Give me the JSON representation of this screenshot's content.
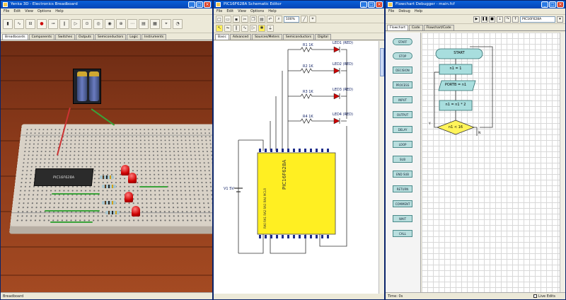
{
  "window1": {
    "title": "Yenka 3D - Electronics Breadboard",
    "menu": [
      "File",
      "Edit",
      "View",
      "Options",
      "Help"
    ],
    "tabs": [
      "Breadboards",
      "Components",
      "Switches",
      "Outputs",
      "Semiconductors",
      "Logic",
      "Instruments"
    ],
    "chip_label": "PIC16F628A",
    "status": "Breadboard"
  },
  "window2": {
    "title": "PIC16F628A Schematic Editor",
    "menu": [
      "File",
      "Edit",
      "View",
      "Options",
      "Help"
    ],
    "zoom": "100%",
    "tabs": [
      "Basic",
      "Advanced",
      "Sources/Meters",
      "Semiconductors",
      "Digital"
    ],
    "resistors": [
      "R1 1K",
      "R2 1K",
      "R3 1K",
      "R4 1K"
    ],
    "leds": [
      "LED1 (RED)",
      "LED2 (RED)",
      "LED3 (RED)",
      "LED4 (RED)"
    ],
    "battery_label": "V1 5V",
    "chip_label": "PIC16F628A",
    "chip_side_label": "RA0  RA1  RA2  RA3  RA4  MCLR"
  },
  "window3": {
    "title": "Flowchart Debugger - main.fcf",
    "menu": [
      "File",
      "Debug",
      "Help"
    ],
    "device": "PIC16F628A",
    "tabs": [
      "Flowchart",
      "Code",
      "Flowchart/Code"
    ],
    "palette": [
      "START",
      "STOP",
      "DECISION",
      "PROCESS",
      "INPUT",
      "OUTPUT",
      "DELAY",
      "LOOP",
      "SUB",
      "END SUB",
      "RETURN",
      "COMMENT",
      "WAIT",
      "CALL"
    ],
    "flowchart": {
      "start": "START",
      "step1": "n1 = 1",
      "step2": "PORTB = n1",
      "step3": "n1 = n1 * 2",
      "decision": "n1 < 16",
      "yes": "Y",
      "no": "N"
    },
    "status_time": "Time: 0s",
    "status_toggle": "Live Edits"
  }
}
